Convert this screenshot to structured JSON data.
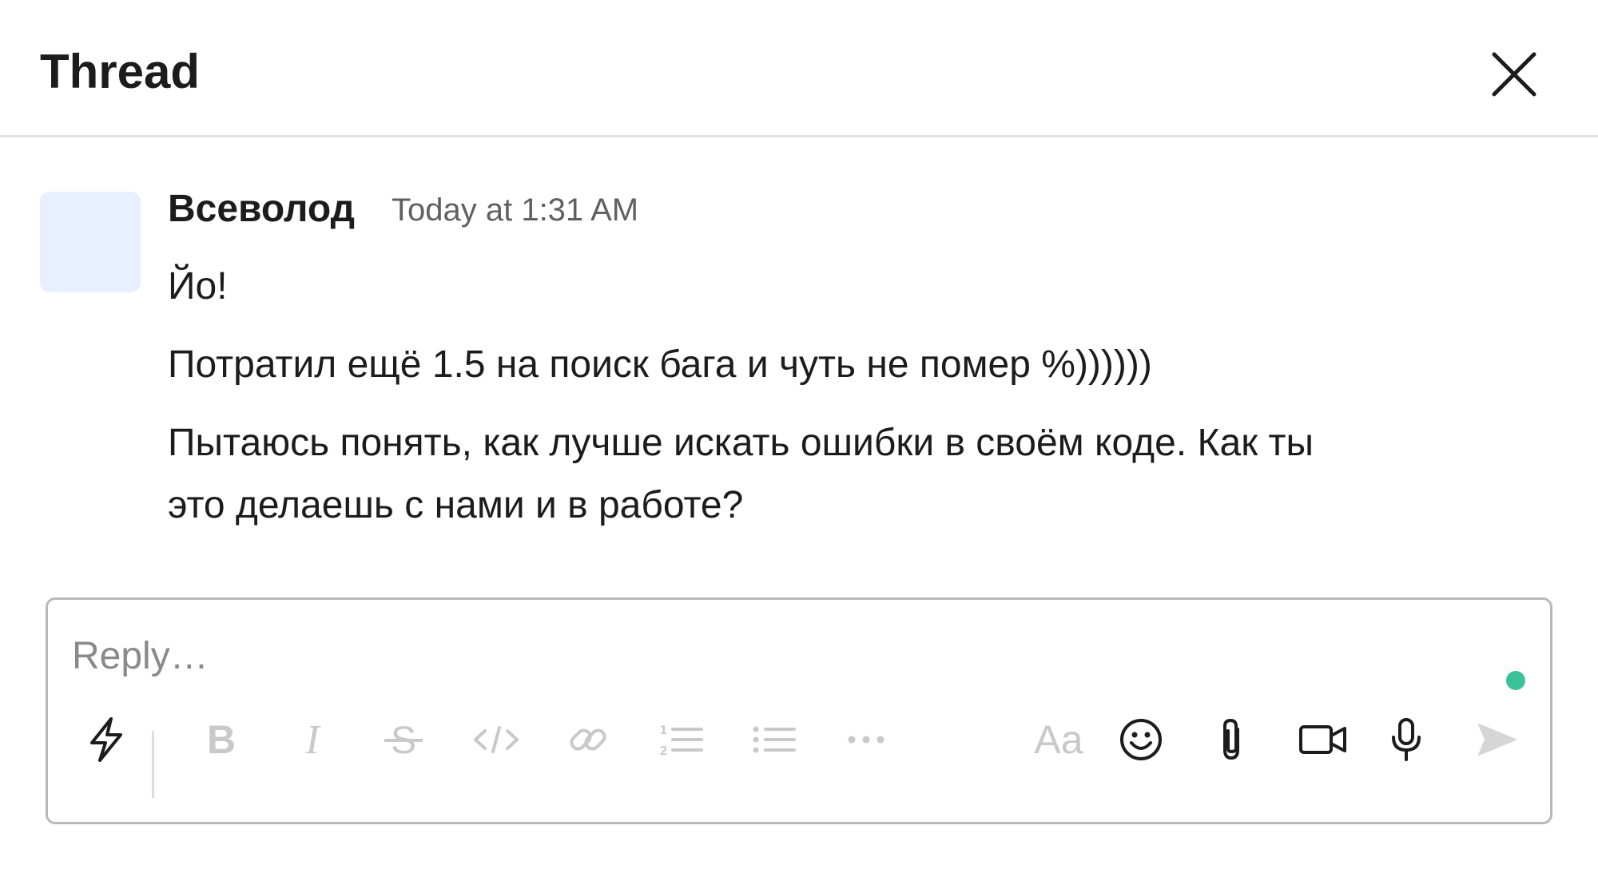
{
  "header": {
    "title": "Thread",
    "close_icon": "close-icon"
  },
  "message": {
    "author": "Всеволод",
    "timestamp": "Today at 1:31 AM",
    "lines": [
      "Йо!",
      "Потратил ещё 1.5 на поиск бага и чуть не помер %))))))",
      "Пытаюсь понять, как лучше искать ошибки в своём коде. Как ты",
      "это делаешь с нами и в работе?"
    ]
  },
  "composer": {
    "placeholder": "Reply…",
    "format_label": "Aa",
    "toolbar_icons": [
      "shortcuts-icon",
      "bold-icon",
      "italic-icon",
      "strikethrough-icon",
      "code-icon",
      "link-icon",
      "ordered-list-icon",
      "bulleted-list-icon",
      "more-icon",
      "formatting-icon",
      "emoji-icon",
      "attach-icon",
      "video-icon",
      "microphone-icon",
      "send-icon"
    ]
  },
  "colors": {
    "text": "#1d1c1d",
    "muted": "#616061",
    "disabled_icon": "#c9c9c9",
    "active_icon": "#1d1c1d",
    "presence": "#3cc29a",
    "avatar_bg": "#e8efff",
    "border": "#b8b8b8"
  }
}
